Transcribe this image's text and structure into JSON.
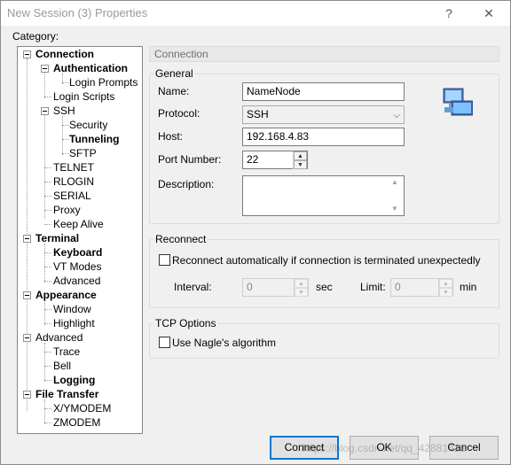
{
  "window": {
    "title": "New Session (3) Properties",
    "help_glyph": "?",
    "close_glyph": "✕"
  },
  "category_label": "Category:",
  "tree": [
    {
      "label": "Connection",
      "bold": true,
      "selected": true
    },
    {
      "label": "Authentication",
      "bold": true
    },
    {
      "label": "Login Prompts",
      "bold": false
    },
    {
      "label": "Login Scripts",
      "bold": false
    },
    {
      "label": "SSH",
      "bold": false
    },
    {
      "label": "Security",
      "bold": false
    },
    {
      "label": "Tunneling",
      "bold": true
    },
    {
      "label": "SFTP",
      "bold": false
    },
    {
      "label": "TELNET",
      "bold": false
    },
    {
      "label": "RLOGIN",
      "bold": false
    },
    {
      "label": "SERIAL",
      "bold": false
    },
    {
      "label": "Proxy",
      "bold": false
    },
    {
      "label": "Keep Alive",
      "bold": false
    },
    {
      "label": "Terminal",
      "bold": true
    },
    {
      "label": "Keyboard",
      "bold": true
    },
    {
      "label": "VT Modes",
      "bold": false
    },
    {
      "label": "Advanced",
      "bold": false
    },
    {
      "label": "Appearance",
      "bold": true
    },
    {
      "label": "Window",
      "bold": false
    },
    {
      "label": "Highlight",
      "bold": false
    },
    {
      "label": "Advanced",
      "bold": false
    },
    {
      "label": "Trace",
      "bold": false
    },
    {
      "label": "Bell",
      "bold": false
    },
    {
      "label": "Logging",
      "bold": true
    },
    {
      "label": "File Transfer",
      "bold": true
    },
    {
      "label": "X/YMODEM",
      "bold": false
    },
    {
      "label": "ZMODEM",
      "bold": false
    }
  ],
  "panel": {
    "header": "Connection",
    "general": {
      "title": "General",
      "name_label": "Name:",
      "name_value": "NameNode",
      "protocol_label": "Protocol:",
      "protocol_value": "SSH",
      "host_label": "Host:",
      "host_value": "192.168.4.83",
      "port_label": "Port Number:",
      "port_value": "22",
      "description_label": "Description:",
      "description_value": ""
    },
    "reconnect": {
      "title": "Reconnect",
      "checkbox_label": "Reconnect automatically if connection is terminated unexpectedly",
      "checked": false,
      "interval_label": "Interval:",
      "interval_value": "0",
      "sec_label": "sec",
      "limit_label": "Limit:",
      "limit_value": "0",
      "min_label": "min"
    },
    "tcp": {
      "title": "TCP Options",
      "nagle_label": "Use Nagle's algorithm",
      "checked": false
    }
  },
  "buttons": {
    "connect": "Connect",
    "ok": "OK",
    "cancel": "Cancel"
  },
  "watermark": "https://blog.csdn.net/qq_42881421"
}
